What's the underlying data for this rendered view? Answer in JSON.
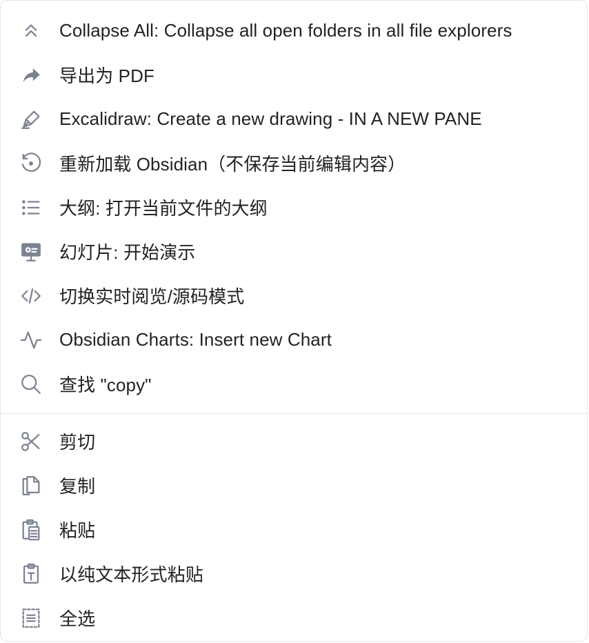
{
  "menu": {
    "commands": [
      {
        "label": "Collapse All: Collapse all open folders in all file explorers",
        "icon": "chevrons-up-icon"
      },
      {
        "label": "导出为 PDF",
        "icon": "share-arrow-icon"
      },
      {
        "label": "Excalidraw: Create a new drawing - IN A NEW PANE",
        "icon": "pen-tool-icon"
      },
      {
        "label": "重新加载 Obsidian（不保存当前编辑内容）",
        "icon": "rotate-ccw-icon"
      },
      {
        "label": "大纲: 打开当前文件的大纲",
        "icon": "list-icon"
      },
      {
        "label": "幻灯片: 开始演示",
        "icon": "presentation-icon"
      },
      {
        "label": "切换实时阅览/源码模式",
        "icon": "code-icon"
      },
      {
        "label": "Obsidian Charts: Insert new Chart",
        "icon": "activity-icon"
      },
      {
        "label": "查找 \"copy\"",
        "icon": "search-icon"
      }
    ],
    "edit": [
      {
        "label": "剪切",
        "icon": "scissors-icon"
      },
      {
        "label": "复制",
        "icon": "copy-icon"
      },
      {
        "label": "粘贴",
        "icon": "clipboard-icon"
      },
      {
        "label": "以纯文本形式粘贴",
        "icon": "clipboard-text-icon"
      },
      {
        "label": "全选",
        "icon": "select-all-icon"
      }
    ]
  },
  "colors": {
    "icon": "#7b8290",
    "text": "#222222",
    "border": "#e3e3e6",
    "separator": "#e2e2e4"
  }
}
